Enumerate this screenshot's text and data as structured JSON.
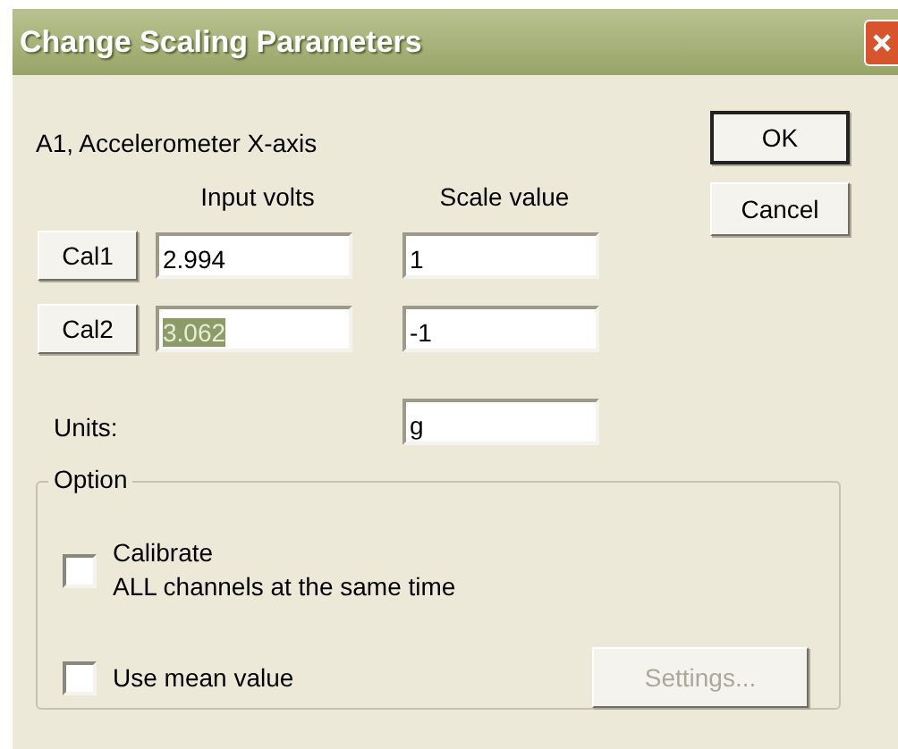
{
  "window": {
    "title": "Change Scaling Parameters"
  },
  "channel_label": "A1, Accelerometer X-axis",
  "buttons": [
    {
      "label": "OK",
      "default": true
    },
    {
      "label": "Cancel",
      "default": false
    }
  ],
  "columns": [
    "Input volts",
    "Scale value"
  ],
  "rows": [
    {
      "button": "Cal1",
      "input_volts": "2.994",
      "input_selected": false,
      "scale_value": "1"
    },
    {
      "button": "Cal2",
      "input_volts": "3.062",
      "input_selected": true,
      "scale_value": "-1"
    }
  ],
  "units": {
    "label": "Units:",
    "value": "g"
  },
  "option": {
    "legend": "Option",
    "checkboxes": [
      {
        "lines": [
          "Calibrate",
          "ALL channels at the same time"
        ],
        "checked": false
      },
      {
        "lines": [
          "Use mean value"
        ],
        "checked": false
      }
    ],
    "settings_button": {
      "label": "Settings...",
      "disabled": true
    }
  }
}
